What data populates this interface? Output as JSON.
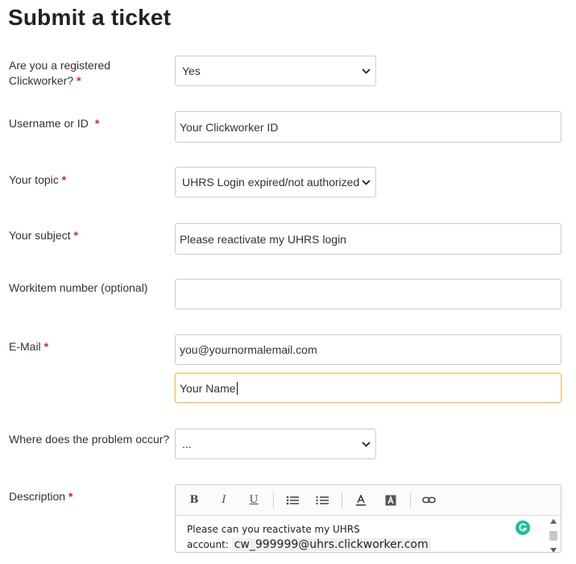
{
  "page": {
    "title": "Submit a ticket"
  },
  "form": {
    "registered": {
      "label_line1": "Are you a registered",
      "label_line2": "Clickworker?",
      "required_mark": "*",
      "value": "Yes"
    },
    "username": {
      "label": "Username or ID",
      "required_mark": "*",
      "value": "Your Clickworker ID"
    },
    "topic": {
      "label": "Your topic",
      "required_mark": "*",
      "value": "UHRS Login expired/not authorized"
    },
    "subject": {
      "label": "Your subject",
      "required_mark": "*",
      "value": "Please reactivate my UHRS login"
    },
    "workitem": {
      "label": "Workitem number (optional)",
      "value": ""
    },
    "email": {
      "label": "E-Mail",
      "required_mark": "*",
      "value": "you@yournormalemail.com"
    },
    "name": {
      "value": "Your Name"
    },
    "problem_location": {
      "label": "Where does the problem occur?",
      "value": "..."
    },
    "description": {
      "label": "Description",
      "required_mark": "*",
      "text_line1": "Please can you reactivate my UHRS",
      "text_line2_prefix": "account: ",
      "text_line2_email": "cw_999999@uhrs.clickworker.com"
    }
  },
  "toolbar": {
    "bold": "B",
    "italic": "I",
    "underline": "U"
  },
  "colors": {
    "required": "#d9232e",
    "focus_border": "#f0c060",
    "grammarly": "#15c39a"
  }
}
